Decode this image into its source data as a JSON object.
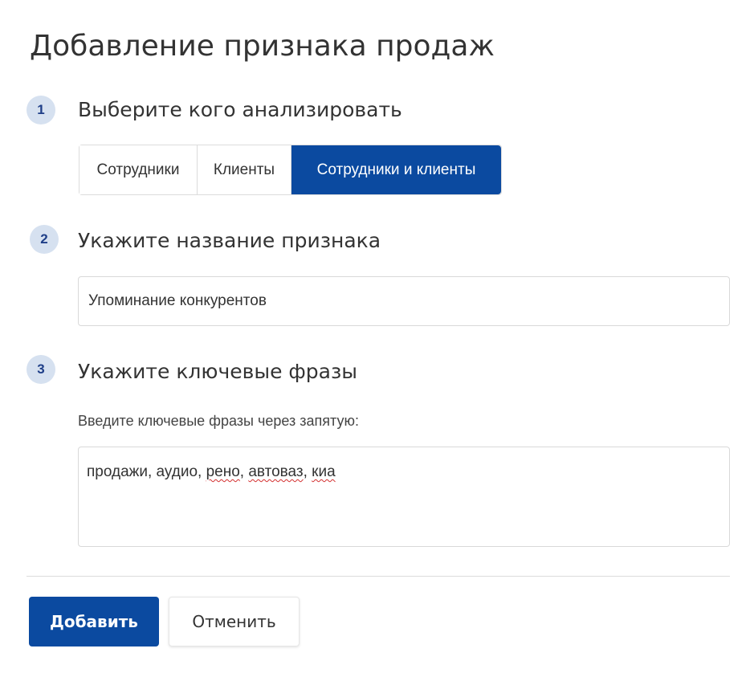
{
  "page": {
    "title": "Добавление признака продаж"
  },
  "steps": [
    {
      "number": "1",
      "title": "Выберите кого анализировать"
    },
    {
      "number": "2",
      "title": "Укажите название признака"
    },
    {
      "number": "3",
      "title": "Укажите ключевые фразы"
    }
  ],
  "segmented": {
    "options": [
      "Сотрудники",
      "Клиенты",
      "Сотрудники и клиенты"
    ],
    "selected": "Сотрудники и клиенты"
  },
  "name_field": {
    "value": "Упоминание конкурентов"
  },
  "phrases": {
    "hint": "Введите ключевые фразы через запятую:",
    "value_parts": [
      "продажи, аудио, ",
      "рено",
      ", ",
      "автоваз",
      ", ",
      "киа"
    ]
  },
  "actions": {
    "add_label": "Добавить",
    "cancel_label": "Отменить"
  },
  "colors": {
    "primary": "#0b4aa0",
    "badge_bg": "#d6e1f0",
    "badge_text": "#1f3f88"
  }
}
